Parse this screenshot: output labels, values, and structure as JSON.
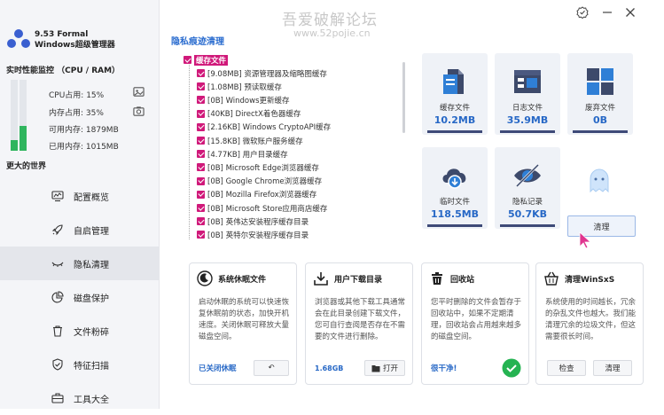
{
  "app": {
    "version_line": "9.53 Formal",
    "name": "Windows超级管理器"
  },
  "watermark": {
    "title": "吾爱破解论坛",
    "url": "www.52pojie.cn"
  },
  "monitor": {
    "title": "实时性能监控 （CPU / RAM）",
    "cpu_label": "CPU占用: 15%",
    "mem_label": "内存占用: 35%",
    "avail_label": "可用内存: 1879MB",
    "used_label": "已用内存: 1015MB",
    "cpu_percent": 15,
    "mem_percent": 35,
    "world": "更大的世界"
  },
  "nav": [
    {
      "label": "配置概览",
      "icon": "monitor-icon"
    },
    {
      "label": "自启管理",
      "icon": "rocket-icon"
    },
    {
      "label": "隐私清理",
      "icon": "eye-closed-icon",
      "active": true
    },
    {
      "label": "磁盘保护",
      "icon": "pie-chart-icon"
    },
    {
      "label": "文件粉碎",
      "icon": "trash-icon"
    },
    {
      "label": "特征扫描",
      "icon": "shield-check-icon"
    },
    {
      "label": "工具大全",
      "icon": "toolbox-icon"
    }
  ],
  "privacy": {
    "title": "隐私痕迹清理",
    "root": "缓存文件",
    "items": [
      "[9.08MB] 资源管理器及缩略图缓存",
      "[1.08MB] 预读取缓存",
      "[0B] Windows更新缓存",
      "[40KB] DirectX着色器缓存",
      "[2.16KB] Windows CryptoAPI缓存",
      "[15.8KB] 微软账户服务缓存",
      "[4.77KB] 用户目录缓存",
      "[0B] Microsoft Edge浏览器缓存",
      "[0B] Google Chrome浏览器缓存",
      "[0B] Mozilla Firefox浏览器缓存",
      "[0B] Microsoft Store应用商店缓存",
      "[0B] 英伟达安装程序缓存目录",
      "[0B] 英特尔安装程序缓存目录"
    ]
  },
  "tiles": [
    {
      "name": "缓存文件",
      "value": "10.2MB",
      "icon": "cache-file-icon"
    },
    {
      "name": "日志文件",
      "value": "35.9MB",
      "icon": "log-file-icon"
    },
    {
      "name": "废弃文件",
      "value": "0B",
      "icon": "windows-grid-icon"
    },
    {
      "name": "临时文件",
      "value": "118.5MB",
      "icon": "cloud-download-icon"
    },
    {
      "name": "隐私记录",
      "value": "50.7KB",
      "icon": "eye-slash-icon"
    }
  ],
  "clean_button": "清理",
  "cards": [
    {
      "title": "系统休眠文件",
      "icon": "moon-icon",
      "desc": "启动休眠的系统可以快速恢复休眠前的状态，加快开机速度。关闭休眠可释放大量磁盘空间。",
      "status": "已关闭休眠",
      "button": "↶"
    },
    {
      "title": "用户下载目录",
      "icon": "download-tray-icon",
      "desc": "浏览器或其他下载工具通常会在此目录创建下载文件，您可自行查阅是否存在不需要的文件进行删除。",
      "size": "1.68GB",
      "button": "打开"
    },
    {
      "title": "回收站",
      "icon": "recycle-bin-icon",
      "desc": "您平时删除的文件会暂存于回收站中，如果不定期清理，回收站会占用越来越多的磁盘空间。",
      "status": "很干净!"
    },
    {
      "title": "清理WinSxS",
      "icon": "basket-icon",
      "desc": "系统使用的时间越长，冗余的杂乱文件也越大。我们能清理冗余的垃圾文件，但这需要很长时间。",
      "button1": "检查",
      "button2": "清理"
    }
  ]
}
